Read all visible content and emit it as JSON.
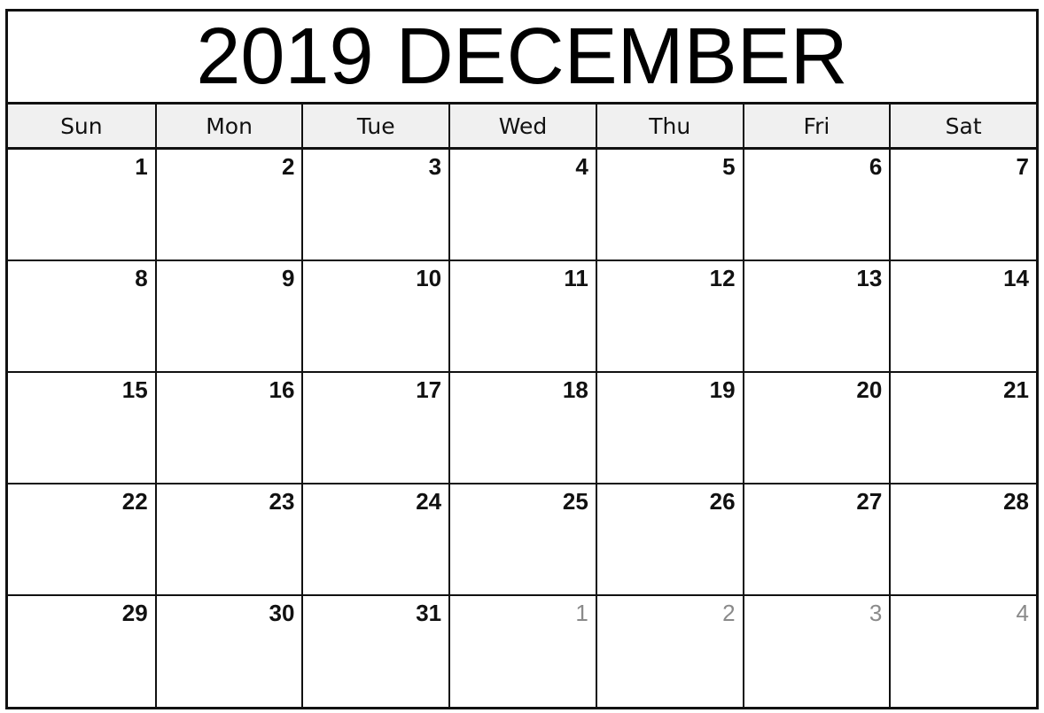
{
  "title": "2019 DECEMBER",
  "weekdays": [
    "Sun",
    "Mon",
    "Tue",
    "Wed",
    "Thu",
    "Fri",
    "Sat"
  ],
  "weeks": [
    [
      {
        "day": "1",
        "current": true
      },
      {
        "day": "2",
        "current": true
      },
      {
        "day": "3",
        "current": true
      },
      {
        "day": "4",
        "current": true
      },
      {
        "day": "5",
        "current": true
      },
      {
        "day": "6",
        "current": true
      },
      {
        "day": "7",
        "current": true
      }
    ],
    [
      {
        "day": "8",
        "current": true
      },
      {
        "day": "9",
        "current": true
      },
      {
        "day": "10",
        "current": true
      },
      {
        "day": "11",
        "current": true
      },
      {
        "day": "12",
        "current": true
      },
      {
        "day": "13",
        "current": true
      },
      {
        "day": "14",
        "current": true
      }
    ],
    [
      {
        "day": "15",
        "current": true
      },
      {
        "day": "16",
        "current": true
      },
      {
        "day": "17",
        "current": true
      },
      {
        "day": "18",
        "current": true
      },
      {
        "day": "19",
        "current": true
      },
      {
        "day": "20",
        "current": true
      },
      {
        "day": "21",
        "current": true
      }
    ],
    [
      {
        "day": "22",
        "current": true
      },
      {
        "day": "23",
        "current": true
      },
      {
        "day": "24",
        "current": true
      },
      {
        "day": "25",
        "current": true
      },
      {
        "day": "26",
        "current": true
      },
      {
        "day": "27",
        "current": true
      },
      {
        "day": "28",
        "current": true
      }
    ],
    [
      {
        "day": "29",
        "current": true
      },
      {
        "day": "30",
        "current": true
      },
      {
        "day": "31",
        "current": true
      },
      {
        "day": "1",
        "current": false
      },
      {
        "day": "2",
        "current": false
      },
      {
        "day": "3",
        "current": false
      },
      {
        "day": "4",
        "current": false
      }
    ]
  ],
  "colors": {
    "current_day": "#111111",
    "other_month_day": "#8a8a8a",
    "header_bg": "#f0f0f0"
  }
}
